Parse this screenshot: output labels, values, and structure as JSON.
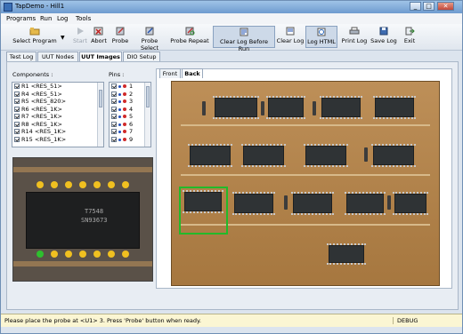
{
  "window": {
    "title": "TapDemo - Hill1",
    "controls": [
      "_",
      "□",
      "✕"
    ]
  },
  "menu": [
    "Programs",
    "Run",
    "Log",
    "Tools"
  ],
  "toolbar": {
    "select_program": "Select Program",
    "start": "Start",
    "abort": "Abort",
    "probe": "Probe",
    "probe_select": "Probe Select",
    "probe_repeat": "Probe Repeat",
    "clear_log_before_run": "Clear Log Before Run",
    "clear_log": "Clear Log",
    "log_html": "Log HTML",
    "print_log": "Print Log",
    "save_log": "Save Log",
    "exit": "Exit"
  },
  "tabs": [
    "Test Log",
    "UUT Nodes",
    "UUT Images",
    "DIO Setup"
  ],
  "components": {
    "label": "Components :",
    "items": [
      "R1 <RES_51>",
      "R4 <RES_51>",
      "R5 <RES_820>",
      "R6 <RES_1K>",
      "R7 <RES_1K>",
      "R8 <RES_1K>",
      "R14 <RES_1K>",
      "R15 <RES_1K>"
    ]
  },
  "pins": {
    "label": "Pins :",
    "items": [
      "1",
      "2",
      "3",
      "4",
      "5",
      "6",
      "7",
      "9"
    ]
  },
  "board_tabs": [
    "Front",
    "Back"
  ],
  "zoom_view": {
    "chip_text_1": "T7548",
    "chip_text_2": "SN93673"
  },
  "status": {
    "message": "Please place the probe at <U1> 3. Press 'Probe' button when ready.",
    "right": "DEBUG"
  }
}
